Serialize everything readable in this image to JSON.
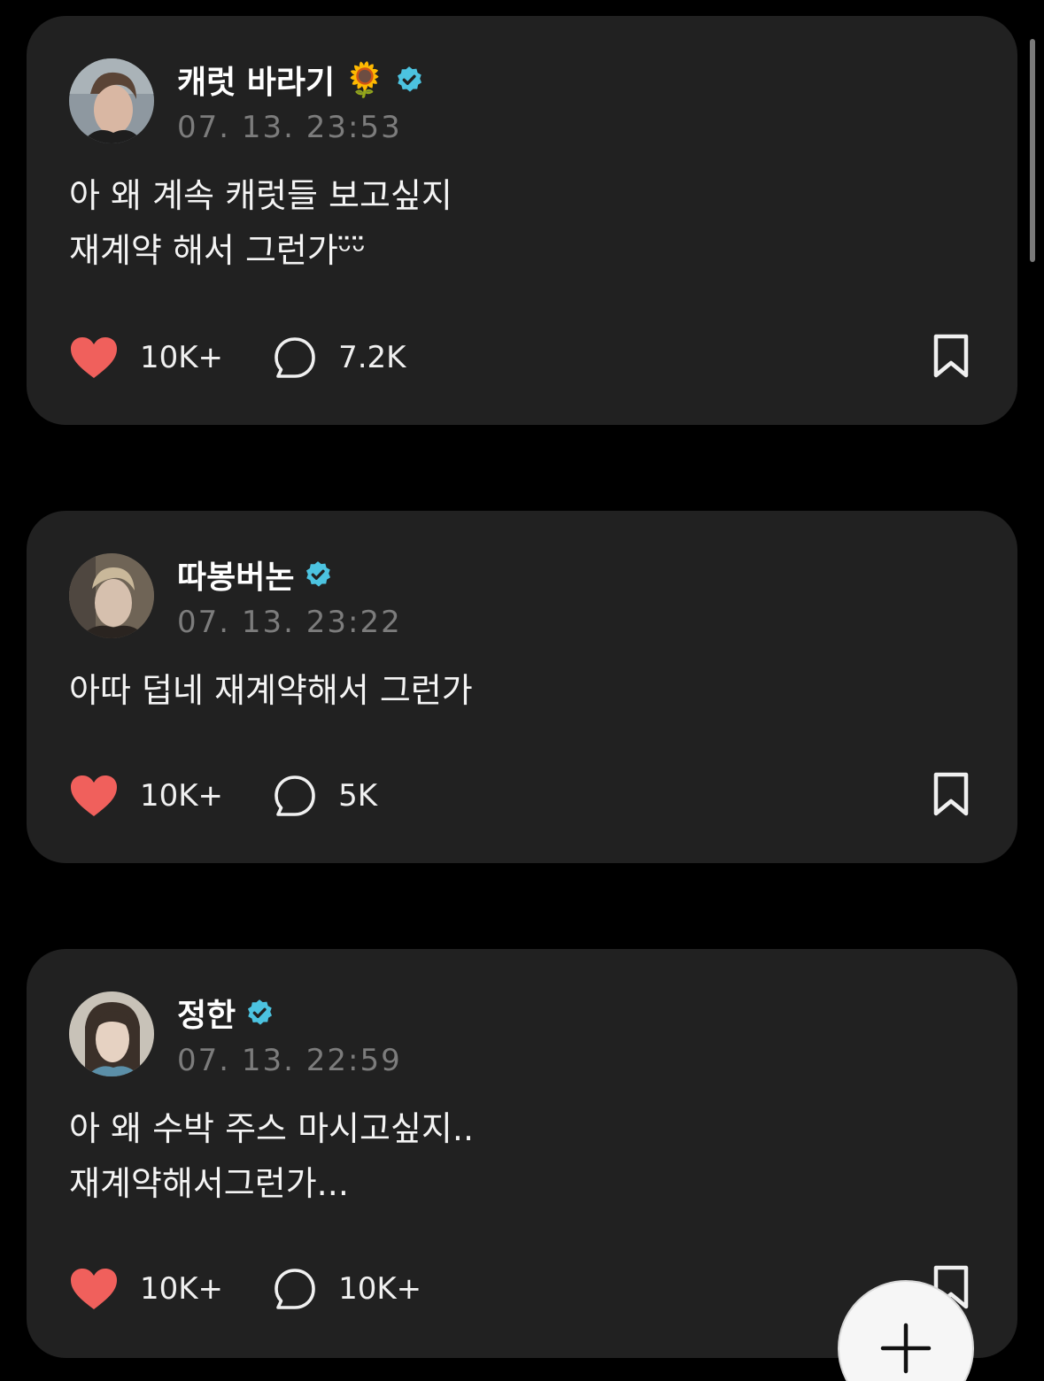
{
  "posts": [
    {
      "author": "캐럿 바라기",
      "emoji": "🌻",
      "verified": true,
      "timestamp": "07. 13. 23:53",
      "lines": [
        "아 왜 계속 캐럿들 보고싶지",
        "재계약 해서 그런가ᵕ̈ᵕ̈"
      ],
      "likes": "10K+",
      "comments": "7.2K",
      "avatar_icon": "avatar-photo"
    },
    {
      "author": "따봉버논",
      "verified": true,
      "timestamp": "07. 13. 23:22",
      "lines": [
        "아따 덥네 재계약해서 그런가"
      ],
      "likes": "10K+",
      "comments": "5K",
      "avatar_icon": "avatar-photo"
    },
    {
      "author": "정한",
      "verified": true,
      "timestamp": "07. 13. 22:59",
      "lines": [
        "아 왜 수박 주스 마시고싶지..",
        "재계약해서그런가..."
      ],
      "likes": "10K+",
      "comments": "10K+",
      "avatar_icon": "avatar-photo"
    }
  ],
  "colors": {
    "background": "#000000",
    "card": "#212121",
    "like": "#f0605c",
    "verified": "#4cc3e0",
    "timestamp": "#7c7c7c"
  },
  "icons": {
    "like": "heart-icon",
    "comment": "speech-bubble-icon",
    "save": "bookmark-icon",
    "verified": "verified-badge-icon",
    "compose": "plus-icon"
  }
}
